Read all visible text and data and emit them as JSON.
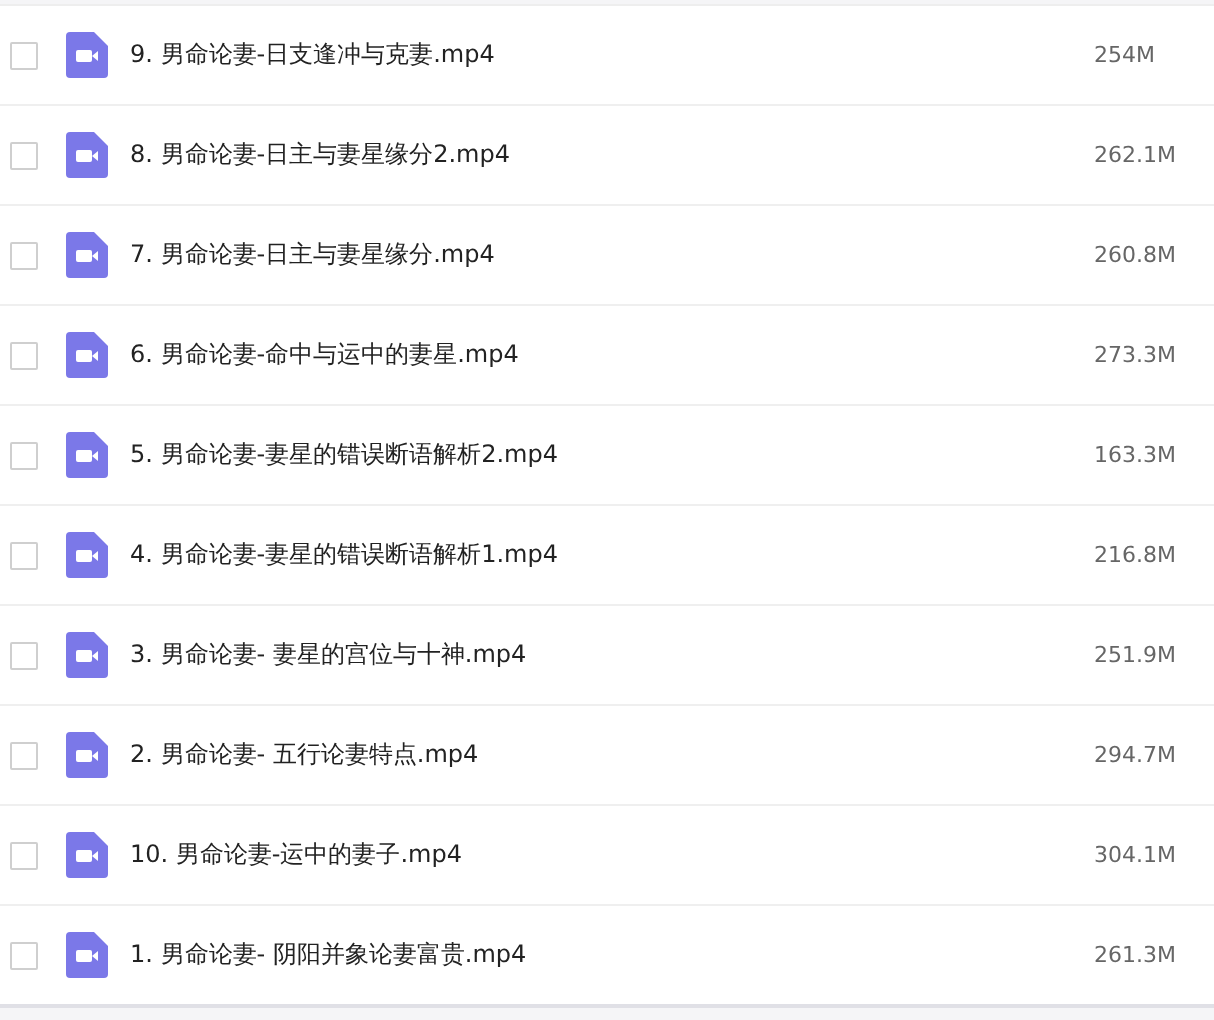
{
  "files": [
    {
      "name": "9. 男命论妻-日支逢冲与克妻.mp4",
      "size": "254M",
      "checked": false
    },
    {
      "name": "8. 男命论妻-日主与妻星缘分2.mp4",
      "size": "262.1M",
      "checked": false
    },
    {
      "name": "7. 男命论妻-日主与妻星缘分.mp4",
      "size": "260.8M",
      "checked": false
    },
    {
      "name": "6. 男命论妻-命中与运中的妻星.mp4",
      "size": "273.3M",
      "checked": false
    },
    {
      "name": "5. 男命论妻-妻星的错误断语解析2.mp4",
      "size": "163.3M",
      "checked": false
    },
    {
      "name": "4. 男命论妻-妻星的错误断语解析1.mp4",
      "size": "216.8M",
      "checked": false
    },
    {
      "name": "3. 男命论妻- 妻星的宫位与十神.mp4",
      "size": "251.9M",
      "checked": false
    },
    {
      "name": "2. 男命论妻- 五行论妻特点.mp4",
      "size": "294.7M",
      "checked": false
    },
    {
      "name": "10. 男命论妻-运中的妻子.mp4",
      "size": "304.1M",
      "checked": false
    },
    {
      "name": "1. 男命论妻- 阴阳并象论妻富贵.mp4",
      "size": "261.3M",
      "checked": false
    }
  ]
}
